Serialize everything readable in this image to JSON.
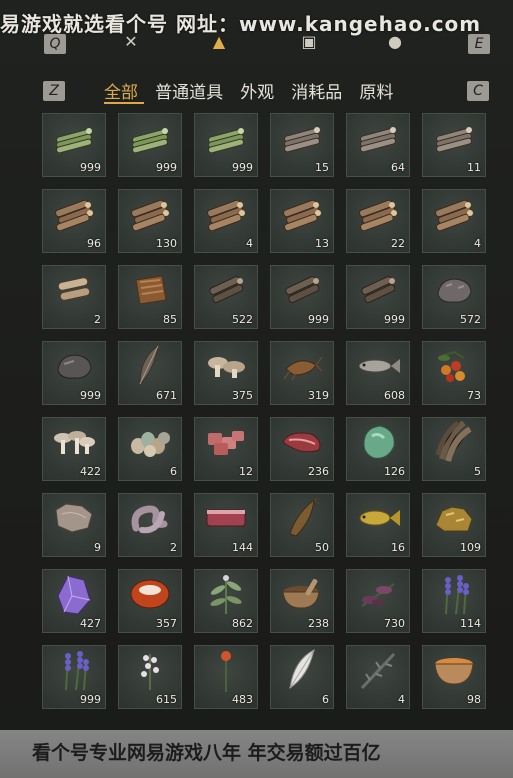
{
  "header": {
    "banner": "易游戏就选看个号  网址：www.kangehao.com",
    "left_key": "Q",
    "right_key": "E"
  },
  "filter": {
    "left_key": "Z",
    "right_key": "C",
    "tabs": [
      "全部",
      "普通道具",
      "外观",
      "消耗品",
      "原料"
    ],
    "active_tab": 0
  },
  "items": [
    [
      {
        "icon": "green-log-bundle-icon",
        "qty": "999"
      },
      {
        "icon": "green-log-bundle-icon",
        "qty": "999"
      },
      {
        "icon": "green-log-bundle-icon",
        "qty": "999"
      },
      {
        "icon": "log-bundle-icon",
        "qty": "15"
      },
      {
        "icon": "log-bundle-icon",
        "qty": "64"
      },
      {
        "icon": "log-bundle-icon",
        "qty": "11"
      }
    ],
    [
      {
        "icon": "log-pile-icon",
        "qty": "96"
      },
      {
        "icon": "log-pile-icon",
        "qty": "130"
      },
      {
        "icon": "log-pile-icon",
        "qty": "4"
      },
      {
        "icon": "log-pile-icon",
        "qty": "13"
      },
      {
        "icon": "log-pile-icon",
        "qty": "22"
      },
      {
        "icon": "log-pile-icon",
        "qty": "4"
      }
    ],
    [
      {
        "icon": "log-stack-icon",
        "qty": "2"
      },
      {
        "icon": "bark-icon",
        "qty": "85"
      },
      {
        "icon": "dark-log-icon",
        "qty": "522"
      },
      {
        "icon": "dark-log-icon",
        "qty": "999"
      },
      {
        "icon": "dark-log-icon",
        "qty": "999"
      },
      {
        "icon": "ore-rock-icon",
        "qty": "572"
      }
    ],
    [
      {
        "icon": "stone-icon",
        "qty": "999"
      },
      {
        "icon": "feather-icon",
        "qty": "671"
      },
      {
        "icon": "mushroom-icon",
        "qty": "375"
      },
      {
        "icon": "shrimp-icon",
        "qty": "319"
      },
      {
        "icon": "fish-icon",
        "qty": "608"
      },
      {
        "icon": "berry-icon",
        "qty": "73"
      }
    ],
    [
      {
        "icon": "mushroom-cluster-icon",
        "qty": "422"
      },
      {
        "icon": "eggs-icon",
        "qty": "6"
      },
      {
        "icon": "raw-meat-icon",
        "qty": "12"
      },
      {
        "icon": "steak-icon",
        "qty": "236"
      },
      {
        "icon": "jade-icon",
        "qty": "126"
      },
      {
        "icon": "feather-bundle-icon",
        "qty": "5"
      }
    ],
    [
      {
        "icon": "hide-icon",
        "qty": "9"
      },
      {
        "icon": "intestine-icon",
        "qty": "2"
      },
      {
        "icon": "meat-slab-icon",
        "qty": "144"
      },
      {
        "icon": "catfish-icon",
        "qty": "50"
      },
      {
        "icon": "golden-fish-icon",
        "qty": "16"
      },
      {
        "icon": "gold-ore-icon",
        "qty": "109"
      }
    ],
    [
      {
        "icon": "amethyst-icon",
        "qty": "427"
      },
      {
        "icon": "agate-icon",
        "qty": "357"
      },
      {
        "icon": "herb-icon",
        "qty": "862"
      },
      {
        "icon": "mortar-icon",
        "qty": "238"
      },
      {
        "icon": "purple-flower-icon",
        "qty": "730"
      },
      {
        "icon": "lavender-icon",
        "qty": "114"
      }
    ],
    [
      {
        "icon": "lavender-icon",
        "qty": "999"
      },
      {
        "icon": "white-flower-icon",
        "qty": "615"
      },
      {
        "icon": "red-flower-icon",
        "qty": "483"
      },
      {
        "icon": "white-feather-icon",
        "qty": "6"
      },
      {
        "icon": "thorny-branch-icon",
        "qty": "4"
      },
      {
        "icon": "soup-bowl-icon",
        "qty": "98"
      }
    ]
  ],
  "footer": {
    "text": "看个号专业网易游戏八年  年交易额过百亿"
  }
}
